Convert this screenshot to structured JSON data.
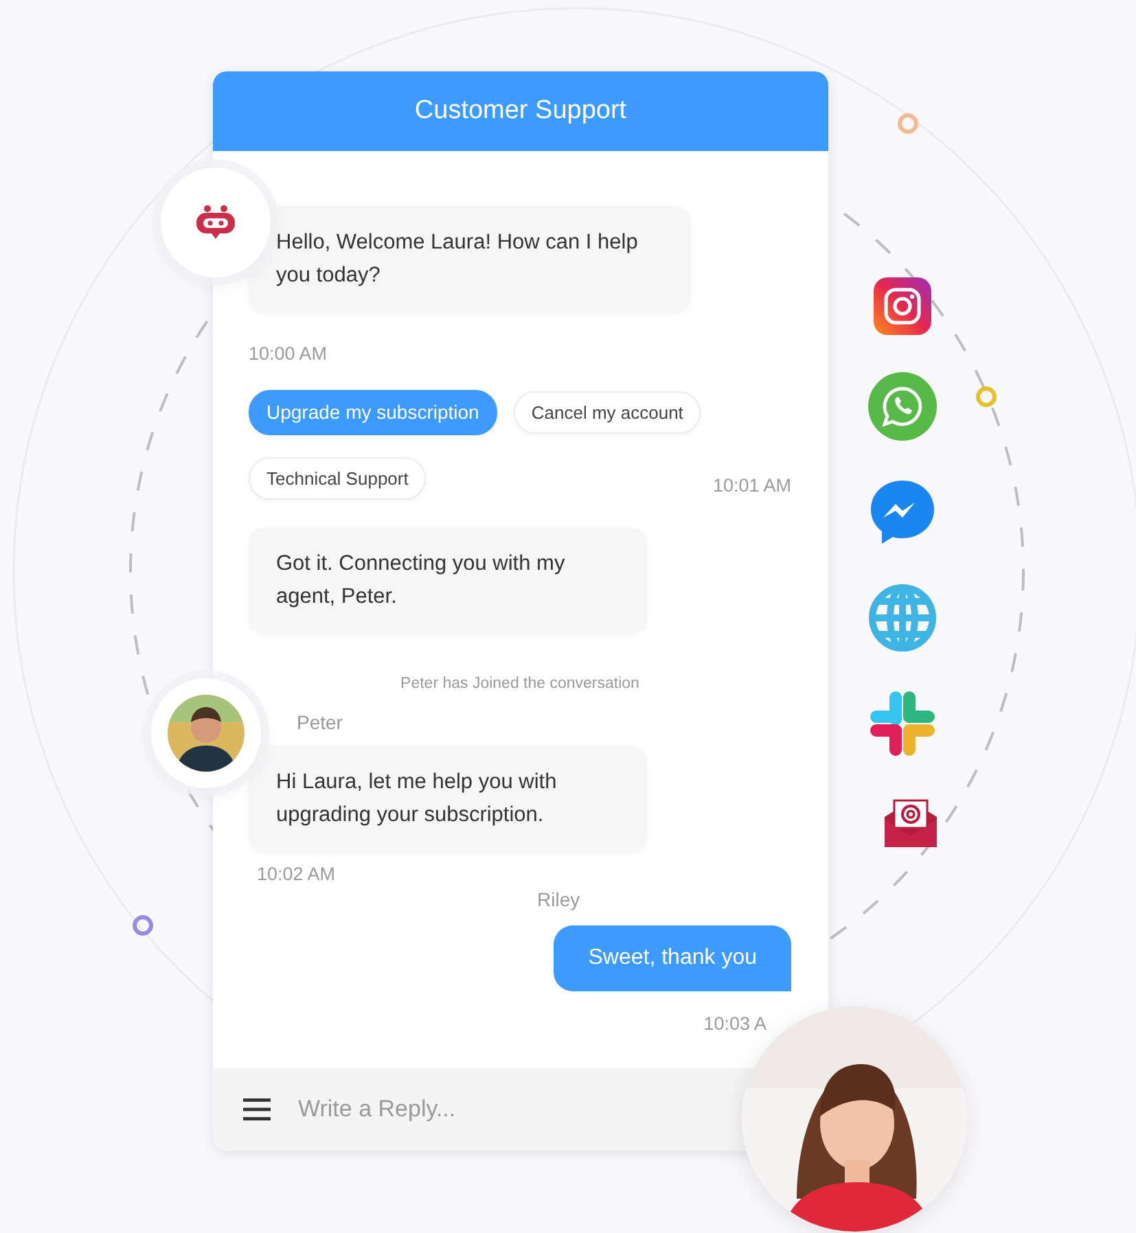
{
  "header": {
    "title": "Customer Support"
  },
  "messages": [
    {
      "kind": "bot",
      "avatar": true,
      "text": "Hello, Welcome Laura! How can I help you today?",
      "time": "10:00 AM"
    },
    {
      "kind": "options",
      "options": [
        {
          "label": "Upgrade my subscription",
          "selected": true
        },
        {
          "label": "Cancel my account",
          "selected": false
        },
        {
          "label": "Technical Support",
          "selected": false
        }
      ],
      "time": "10:01 AM"
    },
    {
      "kind": "bot",
      "avatar": false,
      "text": "Got it. Connecting you with my agent, Peter."
    },
    {
      "kind": "notice",
      "text": "Peter has Joined the conversation"
    },
    {
      "kind": "agent",
      "avatar": true,
      "sender": "Peter",
      "text": "Hi Laura, let me help you with upgrading your subscription.",
      "time": "10:02 AM"
    },
    {
      "kind": "user",
      "sender": "Riley",
      "text": "Sweet, thank you",
      "time": "10:03 A"
    }
  ],
  "composer": {
    "placeholder": "Write a Reply..."
  }
}
